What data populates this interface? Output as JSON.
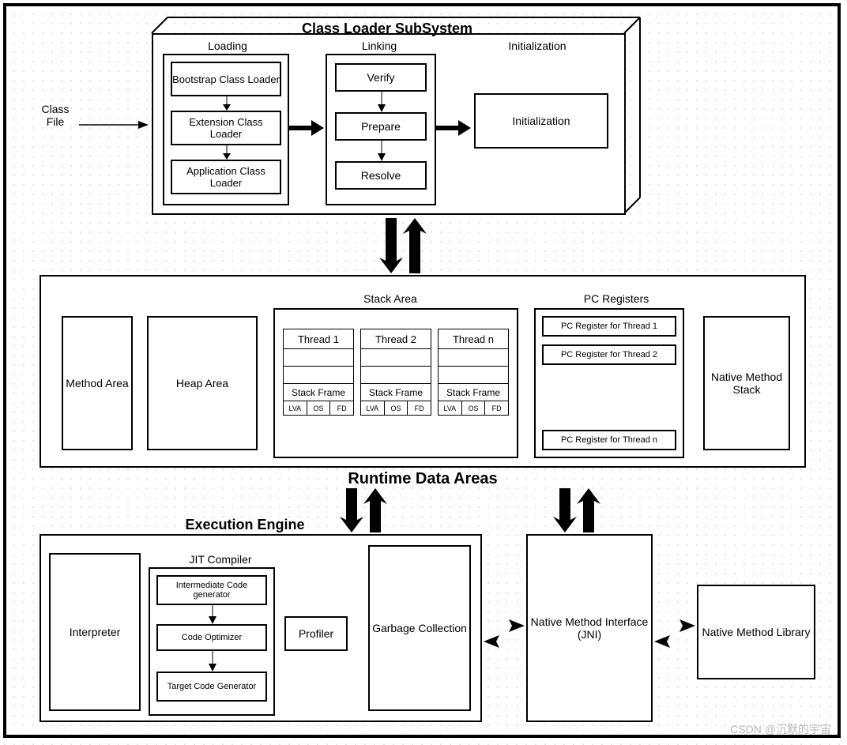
{
  "classFile": "Class\nFile",
  "classLoader": {
    "title": "Class Loader SubSystem",
    "loading": {
      "label": "Loading",
      "items": [
        "Bootstrap Class Loader",
        "Extension Class Loader",
        "Application Class Loader"
      ]
    },
    "linking": {
      "label": "Linking",
      "items": [
        "Verify",
        "Prepare",
        "Resolve"
      ]
    },
    "init": {
      "label": "Initialization",
      "box": "Initialization"
    }
  },
  "runtime": {
    "title": "Runtime Data Areas",
    "methodArea": "Method Area",
    "heapArea": "Heap Area",
    "stackArea": {
      "label": "Stack Area",
      "threads": [
        "Thread 1",
        "Thread 2",
        "Thread n"
      ],
      "frameLabel": "Stack Frame",
      "cells": [
        "LVA",
        "OS",
        "FD"
      ]
    },
    "pcRegisters": {
      "label": "PC Registers",
      "items": [
        "PC Register for Thread 1",
        "PC Register for Thread 2",
        "PC Register for Thread n"
      ]
    },
    "nativeStack": "Native Method Stack"
  },
  "execEngine": {
    "title": "Execution Engine",
    "interpreter": "Interpreter",
    "jit": {
      "label": "JIT Compiler",
      "items": [
        "Intermediate Code generator",
        "Code Optimizer",
        "Target Code Generator"
      ]
    },
    "profiler": "Profiler",
    "gc": "Garbage Collection"
  },
  "jni": "Native Method Interface (JNI)",
  "nativeLib": "Native Method Library",
  "watermark": "CSDN @沉默的宇宙"
}
